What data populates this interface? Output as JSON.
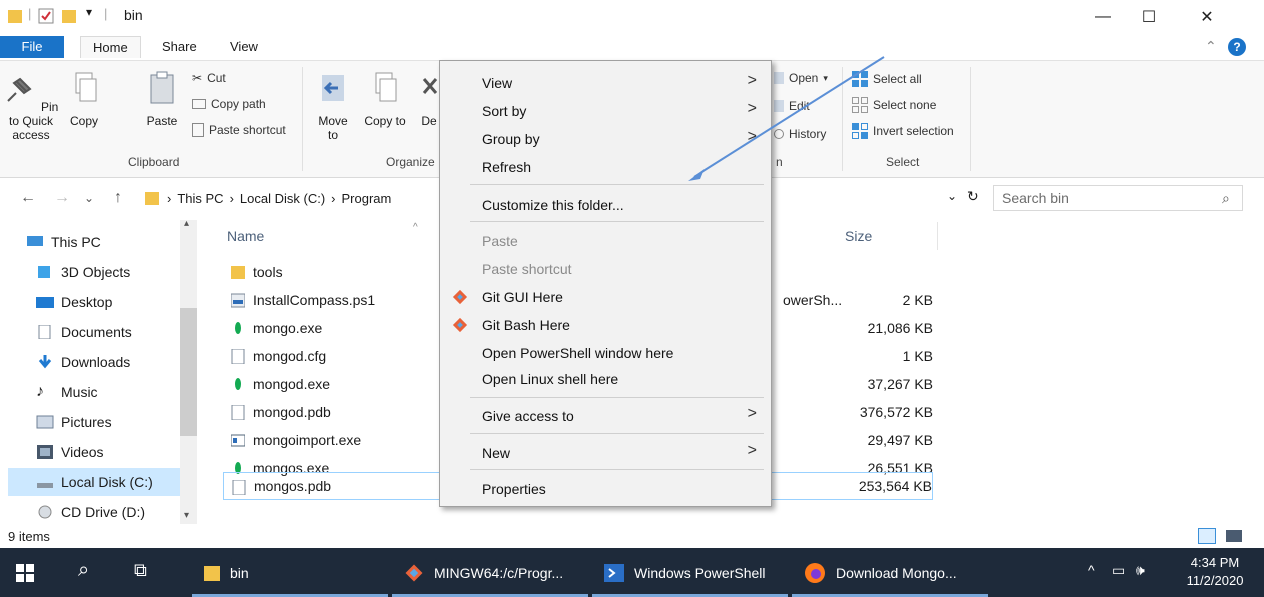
{
  "window": {
    "title": "bin",
    "controls": {
      "minimize": "—",
      "maximize": "☐",
      "close": "✕"
    }
  },
  "ribbon_tabs": [
    "File",
    "Home",
    "Share",
    "View"
  ],
  "ribbon": {
    "clipboard": {
      "pin_label": "Pin to Quick access",
      "copy_label": "Copy",
      "paste_label": "Paste",
      "cut_label": "Cut",
      "copy_path_label": "Copy path",
      "paste_shortcut_label": "Paste shortcut",
      "group_label": "Clipboard"
    },
    "organize": {
      "move_label": "Move to",
      "copy_to_label": "Copy to",
      "delete_label": "De",
      "group_label": "Organize"
    },
    "open": {
      "open_label": "Open",
      "edit_label": "Edit",
      "history_label": "History",
      "group_label": "n"
    },
    "select": {
      "select_all_label": "Select all",
      "select_none_label": "Select none",
      "invert_label": "Invert selection",
      "group_label": "Select"
    }
  },
  "address": {
    "segments": [
      "This PC",
      "Local Disk (C:)",
      "Program"
    ],
    "search_placeholder": "Search bin"
  },
  "nav_pane": {
    "items": [
      {
        "label": "This PC",
        "icon": "computer-icon"
      },
      {
        "label": "3D Objects",
        "icon": "cube-icon"
      },
      {
        "label": "Desktop",
        "icon": "desktop-icon"
      },
      {
        "label": "Documents",
        "icon": "document-icon"
      },
      {
        "label": "Downloads",
        "icon": "download-icon"
      },
      {
        "label": "Music",
        "icon": "music-icon"
      },
      {
        "label": "Pictures",
        "icon": "picture-icon"
      },
      {
        "label": "Videos",
        "icon": "video-icon"
      },
      {
        "label": "Local Disk (C:)",
        "icon": "drive-icon"
      },
      {
        "label": "CD Drive (D:)",
        "icon": "cd-icon"
      }
    ]
  },
  "file_list": {
    "columns": {
      "name": "Name",
      "size": "Size"
    },
    "rows": [
      {
        "name": "tools",
        "type": "",
        "size": "",
        "icon": "folder-icon"
      },
      {
        "name": "InstallCompass.ps1",
        "type": "owerSh...",
        "size": "2 KB",
        "icon": "script-icon"
      },
      {
        "name": "mongo.exe",
        "type": "",
        "size": "21,086 KB",
        "icon": "leaf-icon"
      },
      {
        "name": "mongod.cfg",
        "type": "",
        "size": "1 KB",
        "icon": "file-icon"
      },
      {
        "name": "mongod.exe",
        "type": "",
        "size": "37,267 KB",
        "icon": "leaf-icon"
      },
      {
        "name": "mongod.pdb",
        "type": "",
        "size": "376,572 KB",
        "icon": "file-icon"
      },
      {
        "name": "mongoimport.exe",
        "type": "",
        "size": "29,497 KB",
        "icon": "app-icon"
      },
      {
        "name": "mongos.exe",
        "type": "",
        "size": "26,551 KB",
        "icon": "leaf-icon"
      },
      {
        "name": "mongos.pdb",
        "type": "",
        "size": "253,564 KB",
        "icon": "file-icon"
      }
    ]
  },
  "status": {
    "item_count": "9 items"
  },
  "context_menu": {
    "items": [
      {
        "label": "View",
        "submenu": true,
        "disabled": false
      },
      {
        "label": "Sort by",
        "submenu": true,
        "disabled": false
      },
      {
        "label": "Group by",
        "submenu": true,
        "disabled": false
      },
      {
        "label": "Refresh",
        "submenu": false,
        "disabled": false
      },
      {
        "label": "Customize this folder...",
        "submenu": false,
        "disabled": false
      },
      {
        "label": "Paste",
        "submenu": false,
        "disabled": true
      },
      {
        "label": "Paste shortcut",
        "submenu": false,
        "disabled": true
      },
      {
        "label": "Git GUI Here",
        "submenu": false,
        "disabled": false,
        "icon": "git-icon"
      },
      {
        "label": "Git Bash Here",
        "submenu": false,
        "disabled": false,
        "icon": "git-icon"
      },
      {
        "label": "Open PowerShell window here",
        "submenu": false,
        "disabled": false
      },
      {
        "label": "Open Linux shell here",
        "submenu": false,
        "disabled": false
      },
      {
        "label": "Give access to",
        "submenu": true,
        "disabled": false
      },
      {
        "label": "New",
        "submenu": true,
        "disabled": false
      },
      {
        "label": "Properties",
        "submenu": false,
        "disabled": false
      }
    ],
    "submenu_arrow": ">"
  },
  "taskbar": {
    "apps": [
      {
        "label": "bin",
        "icon": "folder-icon"
      },
      {
        "label": "MINGW64:/c/Progr...",
        "icon": "git-icon"
      },
      {
        "label": "Windows PowerShell",
        "icon": "powershell-icon"
      },
      {
        "label": "Download Mongo...",
        "icon": "firefox-icon"
      }
    ],
    "time": "4:34 PM",
    "date": "11/2/2020"
  },
  "colors": {
    "accent": "#1a73c8",
    "taskbar": "#1e2a3a",
    "selection": "#cce8ff",
    "folder": "#f2c34a"
  }
}
